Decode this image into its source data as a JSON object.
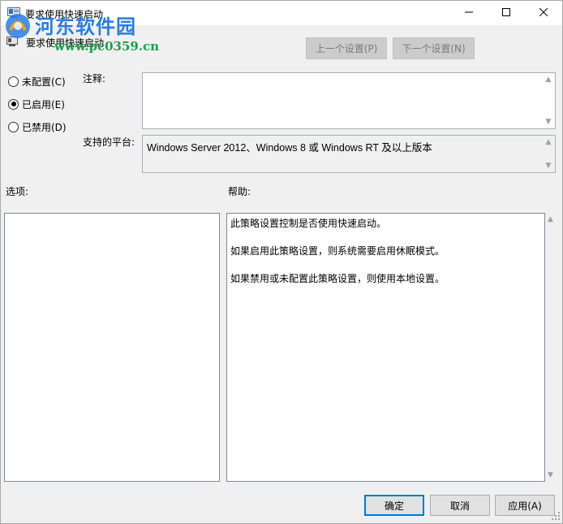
{
  "window": {
    "title": "要求使用快速启动",
    "icon": "policy-settings-icon",
    "controls": {
      "minimize_icon": "minimize-icon",
      "maximize_icon": "maximize-icon",
      "close_icon": "close-icon"
    }
  },
  "watermark": {
    "text": "河东软件园",
    "url": "www.pc0359.cn",
    "colors": {
      "text": "#2a7de1",
      "url": "#1aa14a"
    }
  },
  "header": {
    "setting_name": "要求使用快速启动",
    "prev_button": "上一个设置(P)",
    "next_button": "下一个设置(N)"
  },
  "state": {
    "options": [
      {
        "label": "未配置(C)",
        "checked": false
      },
      {
        "label": "已启用(E)",
        "checked": true
      },
      {
        "label": "已禁用(D)",
        "checked": false
      }
    ]
  },
  "comment": {
    "label": "注释:",
    "value": ""
  },
  "platform": {
    "label": "支持的平台:",
    "value": "Windows Server 2012、Windows 8 或 Windows RT 及以上版本"
  },
  "options_section": {
    "label": "选项:"
  },
  "help_section": {
    "label": "帮助:",
    "lines": [
      "此策略设置控制是否使用快速启动。",
      "如果启用此策略设置，则系统需要启用休眠模式。",
      "如果禁用或未配置此策略设置，则使用本地设置。"
    ]
  },
  "footer": {
    "ok": "确定",
    "cancel": "取消",
    "apply": "应用(A)"
  },
  "colors": {
    "accent": "#0078d7",
    "window_bg": "#f0f0f0",
    "disabled_button_bg": "#cccccc"
  }
}
